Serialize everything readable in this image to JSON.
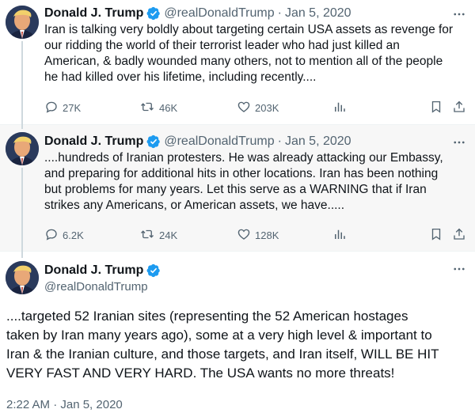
{
  "tweets": [
    {
      "name": "Donald J. Trump",
      "handle": "@realDonaldTrump",
      "separator": "·",
      "date": "Jan 5, 2020",
      "lines": [
        "Iran is talking very boldly about targeting certain USA assets as revenge for",
        "our ridding the world of their terrorist leader who had just killed an",
        "American, & badly wounded many others, not to mention all of the people",
        "he had killed over his lifetime, including recently...."
      ],
      "replies": "27K",
      "retweets": "46K",
      "likes": "203K"
    },
    {
      "name": "Donald J. Trump",
      "handle": "@realDonaldTrump",
      "separator": "·",
      "date": "Jan 5, 2020",
      "lines": [
        "....hundreds of Iranian protesters. He was already attacking our Embassy,",
        "and preparing for additional hits in other locations. Iran has been nothing",
        "but problems for many years. Let this serve as a WARNING that if Iran",
        "strikes any Americans, or American assets, we have....."
      ],
      "replies": "6.2K",
      "retweets": "24K",
      "likes": "128K"
    },
    {
      "name": "Donald J. Trump",
      "handle": "@realDonaldTrump",
      "lines": [
        "....targeted 52 Iranian sites (representing the 52 American hostages",
        "taken by Iran many years ago), some at a very high level & important to",
        "Iran &  the Iranian culture, and those targets, and Iran itself, WILL BE HIT",
        "VERY FAST AND VERY HARD. The USA wants no more threats!"
      ],
      "timestamp": "2:22 AM · Jan 5, 2020"
    }
  ],
  "icons": {
    "more": "more-dots-icon",
    "reply": "reply-icon",
    "retweet": "retweet-icon",
    "like": "heart-icon",
    "views": "views-icon",
    "bookmark": "bookmark-icon",
    "share": "share-icon",
    "verified": "verified-badge-icon"
  },
  "colors": {
    "text": "#0f1419",
    "secondary": "#536471",
    "verified": "#1d9bf0",
    "thread_line": "#cfd9de"
  }
}
